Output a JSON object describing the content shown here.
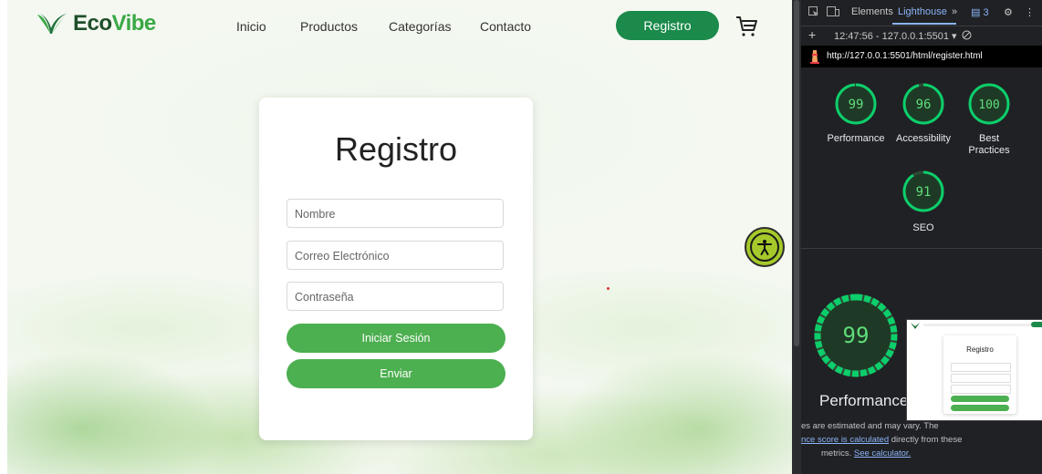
{
  "site": {
    "logo": {
      "part1": "Eco",
      "part2": "Vibe"
    },
    "nav": [
      "Inicio",
      "Productos",
      "Categorías",
      "Contacto"
    ],
    "register_button": "Registro"
  },
  "form": {
    "title": "Registro",
    "name_placeholder": "Nombre",
    "email_placeholder": "Correo Electrónico",
    "password_placeholder": "Contraseña",
    "login_button": "Iniciar Sesión",
    "submit_button": "Enviar"
  },
  "devtools": {
    "tabs": {
      "elements": "Elements",
      "lighthouse": "Lighthouse",
      "more": "»",
      "issues": "3"
    },
    "report_select": "12:47:56 - 127.0.0.1:5501",
    "url": "http://127.0.0.1:5501/html/register.html",
    "scores": [
      {
        "label": "Performance",
        "value": 99
      },
      {
        "label": "Accessibility",
        "value": 96
      },
      {
        "label": "Best Practices",
        "label_line1": "Best",
        "label_line2": "Practices",
        "value": 100
      },
      {
        "label": "SEO",
        "value": 91
      }
    ],
    "big_score": {
      "label": "Performance",
      "value": 99
    },
    "note": {
      "line1": "es are estimated and may vary. The",
      "link1": "nce score is calculated",
      "line2": " directly from these",
      "line3": "metrics.",
      "link2": "See calculator."
    },
    "thumb_title": "Registro"
  },
  "colors": {
    "brand_dark": "#1b8a4a",
    "brand_green": "#4caf50",
    "gauge_green": "#0cce6b",
    "devtools_bg": "#202124",
    "link": "#8ab4f8"
  }
}
